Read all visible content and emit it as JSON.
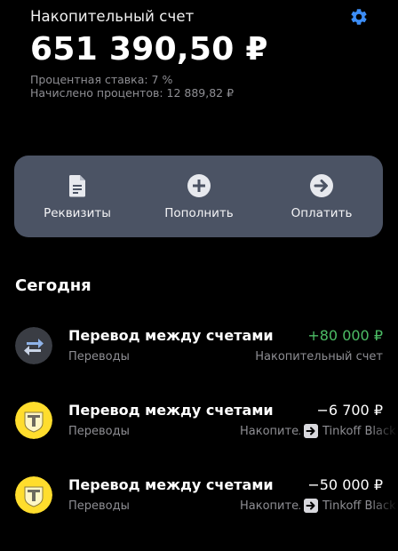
{
  "account": {
    "title": "Накопительный счет",
    "balance": "651 390,50 ₽",
    "rate": "Процентная ставка: 7 %",
    "accrued": "Начислено процентов: 12 889,82 ₽"
  },
  "icons": {
    "settings": "gear-icon",
    "accent": "#3c8df6"
  },
  "actions": [
    {
      "label": "Реквизиты",
      "icon": "document-icon"
    },
    {
      "label": "Пополнить",
      "icon": "plus-circle-icon"
    },
    {
      "label": "Оплатить",
      "icon": "arrow-right-circle-icon"
    }
  ],
  "section_title": "Сегодня",
  "operations": [
    {
      "title": "Перевод между счетами",
      "category": "Переводы",
      "amount": "+80 000 ₽",
      "destination": "Накопительный счет",
      "icon": "transfer-arrows-icon"
    },
    {
      "title": "Перевод между счетами",
      "category": "Переводы",
      "amount": "−6 700 ₽",
      "from": "Накопительный счет",
      "to": "Tinkoff Black",
      "icon": "tinkoff-logo"
    },
    {
      "title": "Перевод между счетами",
      "category": "Переводы",
      "amount": "−50 000 ₽",
      "from": "Накопительный счет",
      "to": "Tinkoff Black",
      "icon": "tinkoff-logo"
    }
  ],
  "colors": {
    "positive": "#4cbd65",
    "panel": "#4b5364",
    "muted": "#8e8e93",
    "brand_yellow": "#ffdd2d"
  }
}
